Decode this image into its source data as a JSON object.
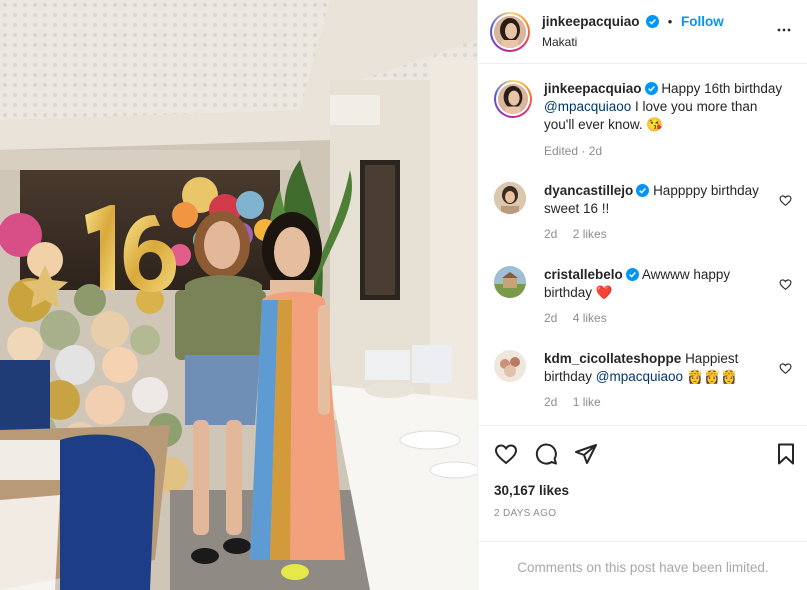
{
  "post": {
    "author": "jinkeepacquiao",
    "follow_label": "Follow",
    "location": "Makati",
    "separator": "•"
  },
  "caption": {
    "author": "jinkeepacquiao",
    "text_before": "Happy 16th birthday",
    "mention": "@mpacquiaoo",
    "text_after": "I love you more than you'll ever know. 😘",
    "meta": "Edited · 2d"
  },
  "comments": [
    {
      "author": "dyancastillejo",
      "verified": true,
      "text": "Happppy birthday sweet 16 !!",
      "time": "2d",
      "likes": "2 likes"
    },
    {
      "author": "cristallebelo",
      "verified": true,
      "text": "Awwww happy birthday ❤️",
      "time": "2d",
      "likes": "4 likes"
    },
    {
      "author": "kdm_cicollateshoppe",
      "verified": false,
      "text_before": "Happiest birthday",
      "mention": "@mpacquiaoo",
      "text_after": "👸👸👸",
      "time": "2d",
      "likes": "1 like"
    }
  ],
  "engagement": {
    "likes": "30,167 likes",
    "date": "2 DAYS AGO"
  },
  "footer": {
    "limited": "Comments on this post have been limited."
  },
  "icons": {
    "verified": "verified-badge-icon",
    "more": "more-horizontal-icon",
    "like": "heart-icon",
    "comment": "comment-icon",
    "share": "share-icon",
    "save": "bookmark-icon"
  },
  "colors": {
    "accent": "#0095f6",
    "verified": "#0095f6",
    "mention": "#00376b",
    "muted": "#8e8e8e",
    "limited": "#a8a8a8"
  }
}
